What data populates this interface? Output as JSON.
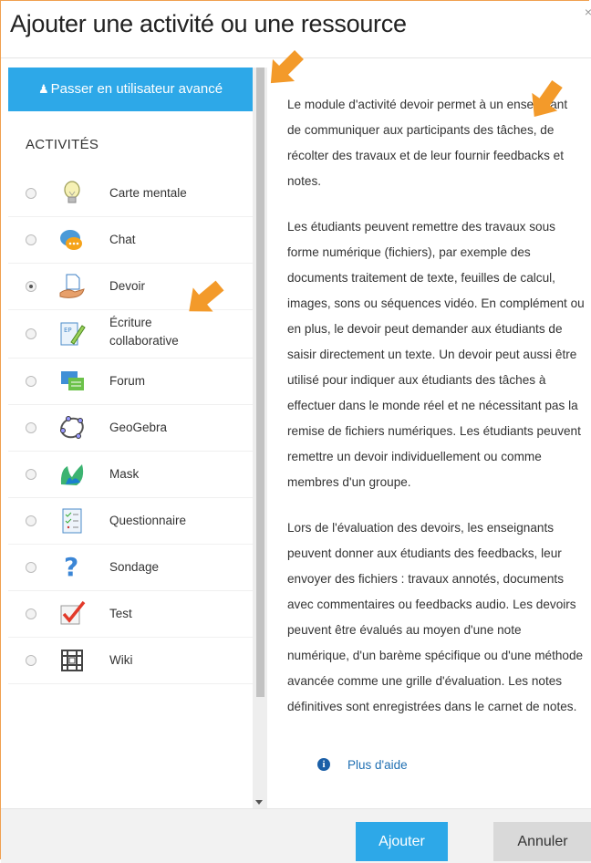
{
  "dialog": {
    "title": "Ajouter une activité ou une ressource",
    "close": "×"
  },
  "sidebar": {
    "advanced_button": "Passer en utilisateur avancé",
    "section_title": "ACTIVITÉS",
    "items": [
      {
        "label": "Carte mentale",
        "icon": "lightbulb-icon",
        "selected": false
      },
      {
        "label": "Chat",
        "icon": "chat-icon",
        "selected": false
      },
      {
        "label": "Devoir",
        "icon": "assignment-icon",
        "selected": true
      },
      {
        "label": "Écriture collaborative",
        "icon": "etherpad-icon",
        "selected": false
      },
      {
        "label": "Forum",
        "icon": "forum-icon",
        "selected": false
      },
      {
        "label": "GeoGebra",
        "icon": "geogebra-icon",
        "selected": false
      },
      {
        "label": "Mask",
        "icon": "mask-icon",
        "selected": false
      },
      {
        "label": "Questionnaire",
        "icon": "questionnaire-icon",
        "selected": false
      },
      {
        "label": "Sondage",
        "icon": "question-mark-icon",
        "selected": false
      },
      {
        "label": "Test",
        "icon": "quiz-check-icon",
        "selected": false
      },
      {
        "label": "Wiki",
        "icon": "wiki-icon",
        "selected": false
      }
    ]
  },
  "description": {
    "paragraphs": [
      "Le module d'activité devoir permet à un enseignant de communiquer aux participants des tâches, de récolter des travaux et de leur fournir feedbacks et notes.",
      "Les étudiants peuvent remettre des travaux sous forme numérique (fichiers), par exemple des documents traitement de texte, feuilles de calcul, images, sons ou séquences vidéo. En complément ou en plus, le devoir peut demander aux étudiants de saisir directement un texte. Un devoir peut aussi être utilisé pour indiquer aux étudiants des tâches à effectuer dans le monde réel et ne nécessitant pas la remise de fichiers numériques. Les étudiants peuvent remettre un devoir individuellement ou comme membres d'un groupe.",
      "Lors de l'évaluation des devoirs, les enseignants peuvent donner aux étudiants des feedbacks, leur envoyer des fichiers : travaux annotés, documents avec commentaires ou feedbacks audio. Les devoirs peuvent être évalués au moyen d'une note numérique, d'un barème spécifique ou d'une méthode avancée comme une grille d'évaluation. Les notes définitives sont enregistrées dans le carnet de notes."
    ],
    "help_link": "Plus d'aide"
  },
  "footer": {
    "add": "Ajouter",
    "cancel": "Annuler"
  },
  "colors": {
    "accent": "#2da8e8",
    "annotation_arrow": "#f39a2a"
  }
}
